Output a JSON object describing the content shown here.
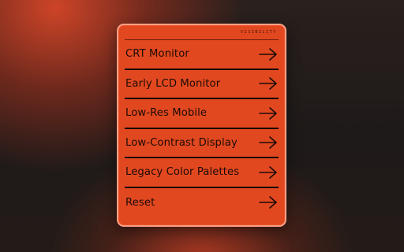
{
  "panel": {
    "title": "VISIBILITY",
    "items": [
      {
        "label": "CRT Monitor",
        "icon": "arrow-right-icon"
      },
      {
        "label": "Early LCD Monitor",
        "icon": "arrow-right-icon"
      },
      {
        "label": "Low-Res Mobile",
        "icon": "arrow-right-icon"
      },
      {
        "label": "Low-Contrast Display",
        "icon": "arrow-right-icon"
      },
      {
        "label": "Legacy Color Palettes",
        "icon": "arrow-right-icon"
      },
      {
        "label": "Reset",
        "icon": "arrow-right-icon"
      }
    ]
  },
  "colors": {
    "panel_background": "#e2481f",
    "text": "#1d0b06",
    "divider": "#1a0a05"
  }
}
